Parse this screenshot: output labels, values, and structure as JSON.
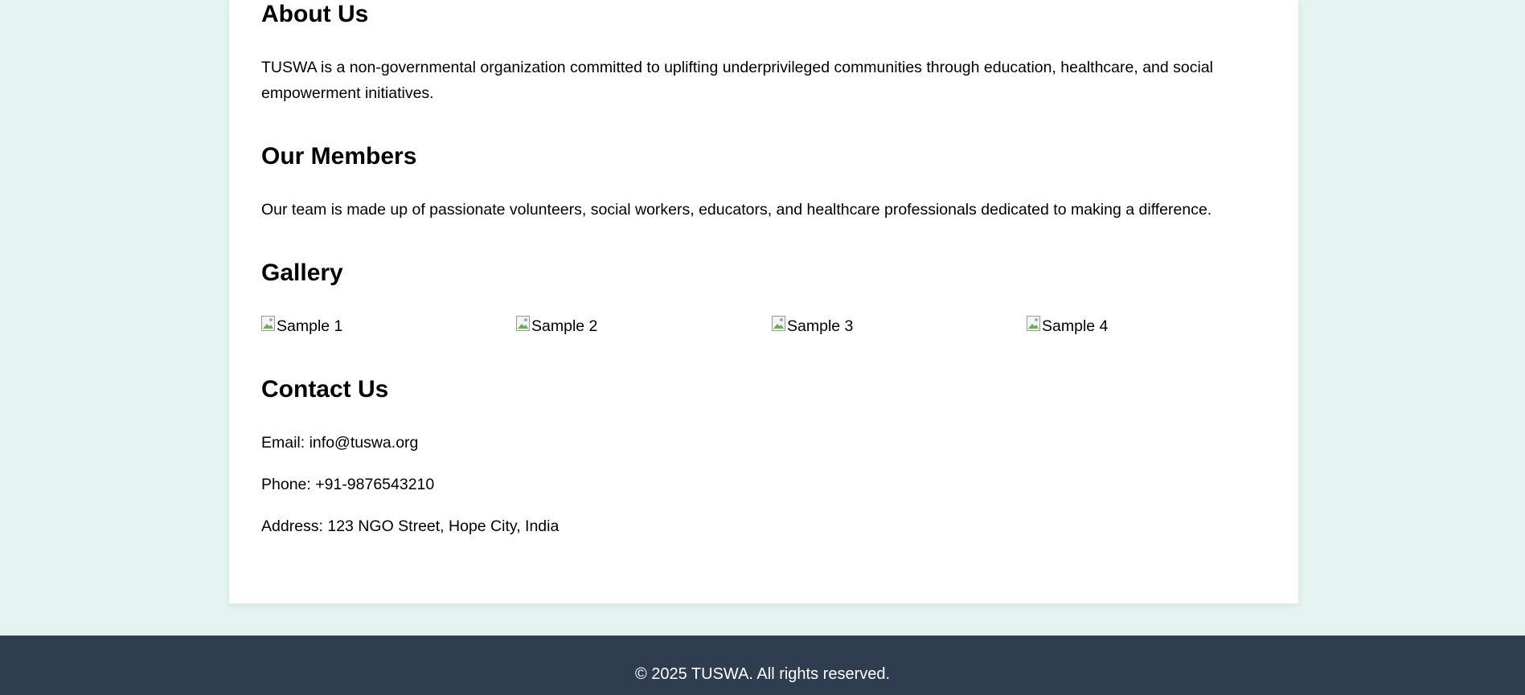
{
  "about": {
    "heading": "About Us",
    "text": "TUSWA is a non-governmental organization committed to uplifting underprivileged communities through education, healthcare, and social empowerment initiatives."
  },
  "members": {
    "heading": "Our Members",
    "text": "Our team is made up of passionate volunteers, social workers, educators, and healthcare professionals dedicated to making a difference."
  },
  "gallery": {
    "heading": "Gallery",
    "items": [
      {
        "alt": "Sample 1"
      },
      {
        "alt": "Sample 2"
      },
      {
        "alt": "Sample 3"
      },
      {
        "alt": "Sample 4"
      }
    ]
  },
  "contact": {
    "heading": "Contact Us",
    "email": "Email: info@tuswa.org",
    "phone": "Phone: +91-9876543210",
    "address": "Address: 123 NGO Street, Hope City, India"
  },
  "footer": {
    "copyright": "© 2025 TUSWA. All rights reserved."
  },
  "colors": {
    "page_bg": "#e6f4f1",
    "card_bg": "#ffffff",
    "footer_bg": "#2e3e50",
    "footer_text": "#ffffff"
  }
}
